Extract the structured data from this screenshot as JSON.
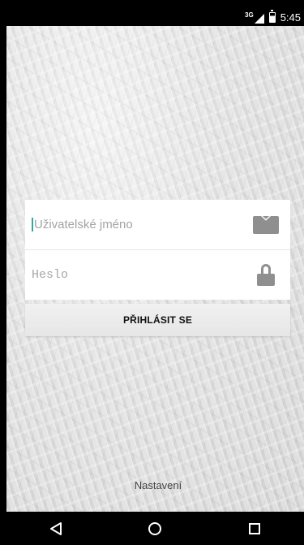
{
  "status_bar": {
    "network_type": "3G",
    "time": "5:45",
    "icons": [
      "signal-icon",
      "battery-icon"
    ]
  },
  "login": {
    "username_placeholder": "Uživatelské jméno",
    "password_placeholder": "Heslo",
    "username_icon": "mail-icon",
    "password_icon": "lock-icon",
    "submit_label": "PŘIHLÁSIT SE"
  },
  "footer": {
    "settings_label": "Nastavení"
  },
  "nav_bar": {
    "buttons": [
      "back-icon",
      "home-icon",
      "recent-apps-icon"
    ]
  },
  "colors": {
    "accent": "#34a89a",
    "icon_gray": "#8f8f8f"
  }
}
